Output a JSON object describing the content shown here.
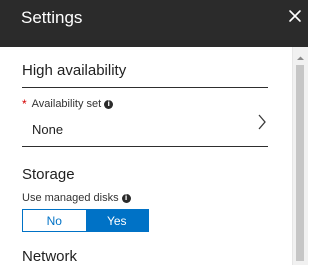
{
  "header": {
    "title": "Settings",
    "close_icon": "close-icon"
  },
  "sections": {
    "high_availability": {
      "title": "High availability",
      "availability_set": {
        "required": "*",
        "label": "Availability set",
        "value": "None",
        "info_icon": "info-icon",
        "chevron_icon": "chevron-right-icon"
      }
    },
    "storage": {
      "title": "Storage",
      "managed_disks": {
        "label": "Use managed disks",
        "info_icon": "info-icon",
        "options": [
          "No",
          "Yes"
        ],
        "selected": "Yes"
      }
    },
    "network": {
      "title": "Network"
    }
  },
  "colors": {
    "header_bg": "#2b2b2b",
    "accent": "#0072c6",
    "required": "#d40000"
  }
}
